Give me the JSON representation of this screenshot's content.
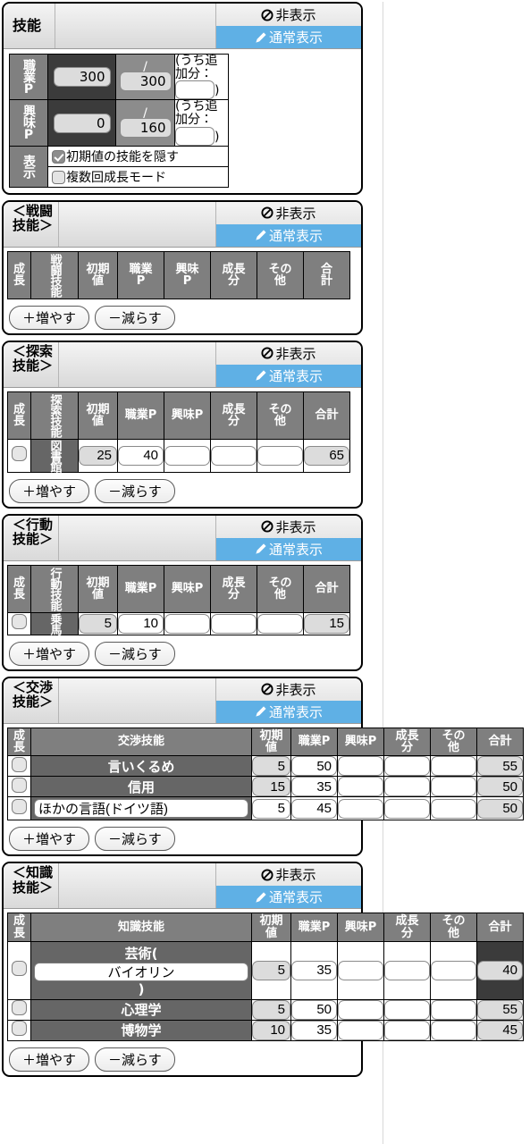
{
  "colors": {
    "accent_blue": "#5fb0e5",
    "header_gray": "#7f7f7f",
    "row_gray": "#666666",
    "dark_cell": "#3b3b3b",
    "readonly_field": "#dcdcdc"
  },
  "tabs": {
    "hide_label": "非表示",
    "normal_label": "通常表示"
  },
  "buttons": {
    "add_label": "＋増やす",
    "remove_label": "－減らす"
  },
  "skill_panel": {
    "title": "技能",
    "job_points": {
      "label": "職業P",
      "used": "300",
      "separator": "/",
      "max": "300",
      "extra_prefix": "(うち追加分：",
      "extra_suffix": ")",
      "extra_value": ""
    },
    "interest_points": {
      "label": "興味P",
      "used": "0",
      "separator": "/",
      "max": "160",
      "extra_prefix": "(うち追加分：",
      "extra_suffix": ")",
      "extra_value": ""
    },
    "display": {
      "label": "表示",
      "options": [
        {
          "label": "初期値の技能を隠す",
          "checked": true
        },
        {
          "label": "複数回成長モード",
          "checked": false
        }
      ]
    }
  },
  "sections": [
    {
      "title": "＜戦闘技能＞",
      "name_header": "戦闘技能",
      "layout": "vertical-name",
      "columns": [
        "成長",
        "戦闘技能",
        "初期値",
        "職業P",
        "興味P",
        "成長分",
        "その他",
        "合計"
      ],
      "column_lines": [
        [
          "成",
          "長"
        ],
        [
          "戦闘技",
          "能"
        ],
        [
          "初期",
          "値"
        ],
        [
          "職業",
          "P"
        ],
        [
          "興味",
          "P"
        ],
        [
          "成長",
          "分"
        ],
        [
          "その",
          "他"
        ],
        [
          "合",
          "計"
        ]
      ],
      "rows": []
    },
    {
      "title": "＜探索技能＞",
      "name_header": "探索技能",
      "layout": "vertical-name",
      "columns": [
        "成長",
        "探索技能",
        "初期値",
        "職業P",
        "興味P",
        "成長分",
        "その他",
        "合計"
      ],
      "column_lines": [
        [
          "成",
          "長"
        ],
        [
          "探索技能"
        ],
        [
          "初期",
          "値"
        ],
        [
          "職業P"
        ],
        [
          "興味P"
        ],
        [
          "成長",
          "分"
        ],
        [
          "その",
          "他"
        ],
        [
          "合計"
        ]
      ],
      "rows": [
        {
          "name": "図書館",
          "editable_name": false,
          "init": "25",
          "job": "40",
          "interest": "",
          "gain": "",
          "other": "",
          "total": "65"
        }
      ]
    },
    {
      "title": "＜行動技能＞",
      "name_header": "行動技能",
      "layout": "vertical-name",
      "columns": [
        "成長",
        "行動技能",
        "初期値",
        "職業P",
        "興味P",
        "成長分",
        "その他",
        "合計"
      ],
      "column_lines": [
        [
          "成",
          "長"
        ],
        [
          "行動技能"
        ],
        [
          "初期",
          "値"
        ],
        [
          "職業P"
        ],
        [
          "興味P"
        ],
        [
          "成長",
          "分"
        ],
        [
          "その",
          "他"
        ],
        [
          "合計"
        ]
      ],
      "rows": [
        {
          "name": "乗馬",
          "editable_name": false,
          "init": "5",
          "job": "10",
          "interest": "",
          "gain": "",
          "other": "",
          "total": "15"
        }
      ]
    },
    {
      "title": "＜交渉技能＞",
      "name_header": "交渉技能",
      "layout": "wide-name",
      "columns": [
        "成長",
        "交渉技能",
        "初期値",
        "職業P",
        "興味P",
        "成長分",
        "その他",
        "合計"
      ],
      "column_lines": [
        [
          "成",
          "長"
        ],
        [
          "交渉技能"
        ],
        [
          "初期",
          "値"
        ],
        [
          "職業P"
        ],
        [
          "興味P"
        ],
        [
          "成長",
          "分"
        ],
        [
          "その",
          "他"
        ],
        [
          "合計"
        ]
      ],
      "rows": [
        {
          "name": "言いくるめ",
          "editable_name": false,
          "init": "5",
          "init_readonly": true,
          "job": "50",
          "interest": "",
          "gain": "",
          "other": "",
          "total": "55"
        },
        {
          "name": "信用",
          "editable_name": false,
          "init": "15",
          "init_readonly": true,
          "job": "35",
          "interest": "",
          "gain": "",
          "other": "",
          "total": "50"
        },
        {
          "name": "ほかの言語(ドイツ語)",
          "editable_name": true,
          "init": "5",
          "init_readonly": false,
          "job": "45",
          "interest": "",
          "gain": "",
          "other": "",
          "total": "50"
        }
      ]
    },
    {
      "title": "＜知識技能＞",
      "name_header": "知識技能",
      "layout": "wide-name",
      "columns": [
        "成長",
        "知識技能",
        "初期値",
        "職業P",
        "興味P",
        "成長分",
        "その他",
        "合計"
      ],
      "column_lines": [
        [
          "成",
          "長"
        ],
        [
          "知識技能"
        ],
        [
          "初期",
          "値"
        ],
        [
          "職業P"
        ],
        [
          "興味P"
        ],
        [
          "成長",
          "分"
        ],
        [
          "その",
          "他"
        ],
        [
          "合計"
        ]
      ],
      "rows": [
        {
          "name_prefix": "芸術(",
          "name": "バイオリン",
          "name_suffix": ")",
          "editable_name": true,
          "init": "5",
          "init_readonly": true,
          "job": "35",
          "interest": "",
          "gain": "",
          "other": "",
          "total": "40",
          "total_dark": true
        },
        {
          "name": "心理学",
          "editable_name": false,
          "init": "5",
          "init_readonly": true,
          "job": "50",
          "interest": "",
          "gain": "",
          "other": "",
          "total": "55"
        },
        {
          "name": "博物学",
          "editable_name": false,
          "init": "10",
          "init_readonly": true,
          "job": "35",
          "interest": "",
          "gain": "",
          "other": "",
          "total": "45"
        }
      ]
    }
  ]
}
